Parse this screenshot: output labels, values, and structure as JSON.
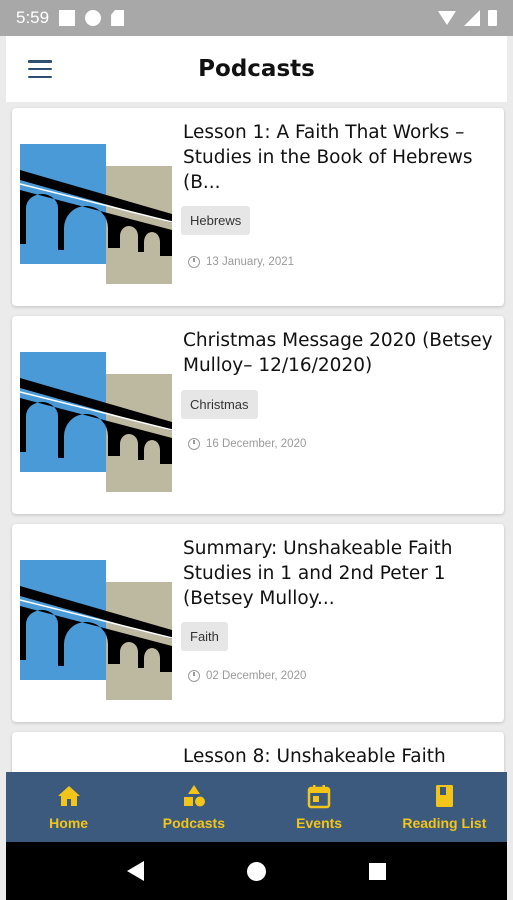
{
  "status_bar": {
    "time": "5:59"
  },
  "app_bar": {
    "title": "Podcasts"
  },
  "podcasts": [
    {
      "title": "Lesson 1: A Faith That Works – Studies in the Book of Hebrews (B...",
      "tag": "Hebrews",
      "date": "13 January, 2021"
    },
    {
      "title": "Christmas Message 2020 (Betsey Mulloy– 12/16/2020)",
      "tag": "Christmas",
      "date": "16 December, 2020"
    },
    {
      "title": "Summary: Unshakeable Faith Studies in 1 and 2nd Peter 1 (Betsey Mulloy...",
      "tag": "Faith",
      "date": "02 December, 2020"
    },
    {
      "title": "Lesson 8: Unshakeable Faith"
    }
  ],
  "bottom_nav": {
    "items": [
      {
        "label": "Home",
        "icon": "home-icon"
      },
      {
        "label": "Podcasts",
        "icon": "shapes-icon"
      },
      {
        "label": "Events",
        "icon": "calendar-icon"
      },
      {
        "label": "Reading List",
        "icon": "book-icon"
      }
    ],
    "accent": "#f3c519",
    "background": "#3b5a7e"
  },
  "thumbnail_colors": {
    "sky": "#4a9ad7",
    "stone": "#bdb8a0",
    "bridge": "#000000"
  }
}
